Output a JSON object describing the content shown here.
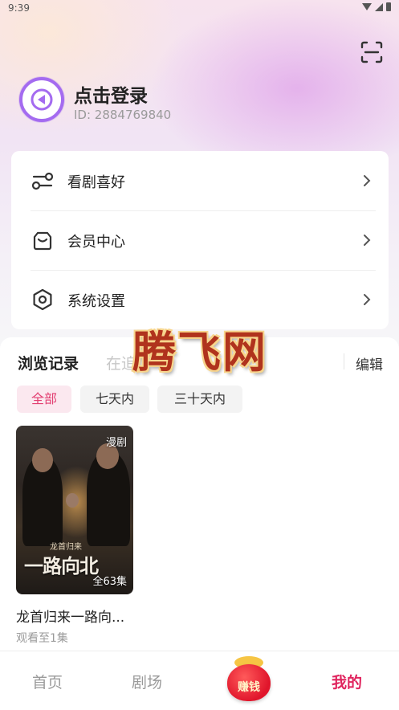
{
  "status_bar": {
    "time": "9:39"
  },
  "profile": {
    "login_text": "点击登录",
    "user_id": "ID: 2884769840"
  },
  "menu": {
    "items": [
      {
        "label": "看剧喜好",
        "icon": "sliders-icon"
      },
      {
        "label": "会员中心",
        "icon": "member-bag-icon"
      },
      {
        "label": "系统设置",
        "icon": "settings-hexagon-icon"
      }
    ]
  },
  "history": {
    "tabs": [
      "浏览记录",
      "在追"
    ],
    "edit_label": "编辑",
    "filters": [
      "全部",
      "七天内",
      "三十天内"
    ],
    "active_filter": "全部",
    "items": [
      {
        "tag": "漫剧",
        "episodes": "全63集",
        "title": "龙首归来一路向...",
        "progress": "观看至1集",
        "poster_art_title": "一路向北",
        "poster_art_subtitle": "龙首归来"
      }
    ]
  },
  "watermark": "腾飞网",
  "bottom_nav": {
    "items": [
      "首页",
      "剧场",
      "赚钱",
      "我的"
    ],
    "active": "我的"
  },
  "colors": {
    "accent": "#e0245e",
    "chip_active_bg": "#fbe8ef",
    "avatar_ring": "#a46bf0"
  }
}
